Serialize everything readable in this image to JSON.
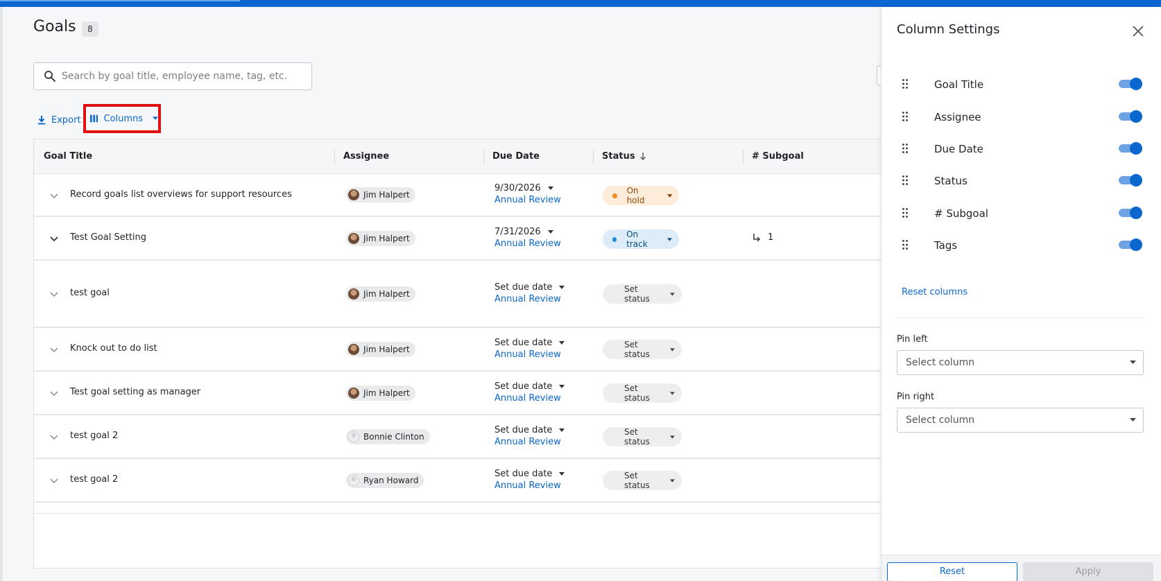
{
  "header": {
    "title": "Goals",
    "count": "8"
  },
  "search": {
    "placeholder": "Search by goal title, employee name, tag, etc."
  },
  "toolbar": {
    "export_label": "Export",
    "columns_label": "Columns"
  },
  "table": {
    "headers": {
      "goal_title": "Goal Title",
      "assignee": "Assignee",
      "due_date": "Due Date",
      "status": "Status",
      "subgoal": "# Subgoal"
    },
    "rows": [
      {
        "title": "Record goals list overviews for support resources",
        "assignee": "Jim Halpert",
        "due": "9/30/2026",
        "review": "Annual Review",
        "status": "On hold",
        "subgoals": ""
      },
      {
        "title": "Test Goal Setting",
        "assignee": "Jim Halpert",
        "due": "7/31/2026",
        "review": "Annual Review",
        "status": "On track",
        "subgoals": "1"
      },
      {
        "title": "test goal",
        "assignee": "Jim Halpert",
        "due": "Set due date",
        "review": "Annual Review",
        "status": "Set status",
        "subgoals": ""
      },
      {
        "title": "Knock out to do list",
        "assignee": "Jim Halpert",
        "due": "Set due date",
        "review": "Annual Review",
        "status": "Set status",
        "subgoals": ""
      },
      {
        "title": "Test goal setting as manager",
        "assignee": "Jim Halpert",
        "due": "Set due date",
        "review": "Annual Review",
        "status": "Set status",
        "subgoals": ""
      },
      {
        "title": "test goal 2",
        "assignee": "Bonnie Clinton",
        "due": "Set due date",
        "review": "Annual Review",
        "status": "Set status",
        "subgoals": ""
      },
      {
        "title": "test goal 2",
        "assignee": "Ryan Howard",
        "due": "Set due date",
        "review": "Annual Review",
        "status": "Set status",
        "subgoals": ""
      }
    ]
  },
  "panel": {
    "title": "Column Settings",
    "columns": [
      {
        "label": "Goal Title",
        "enabled": true
      },
      {
        "label": "Assignee",
        "enabled": true
      },
      {
        "label": "Due Date",
        "enabled": true
      },
      {
        "label": "Status",
        "enabled": true
      },
      {
        "label": "# Subgoal",
        "enabled": true
      },
      {
        "label": "Tags",
        "enabled": true
      }
    ],
    "reset_columns": "Reset columns",
    "pin_left_label": "Pin left",
    "pin_left_value": "Select column",
    "pin_right_label": "Pin right",
    "pin_right_value": "Select column",
    "reset_button": "Reset",
    "apply_button": "Apply"
  },
  "colors": {
    "accent": "#0a67cf",
    "highlight_border": "#e01010",
    "on_hold_bg": "#fdecd9",
    "on_track_bg": "#dcedf9"
  }
}
